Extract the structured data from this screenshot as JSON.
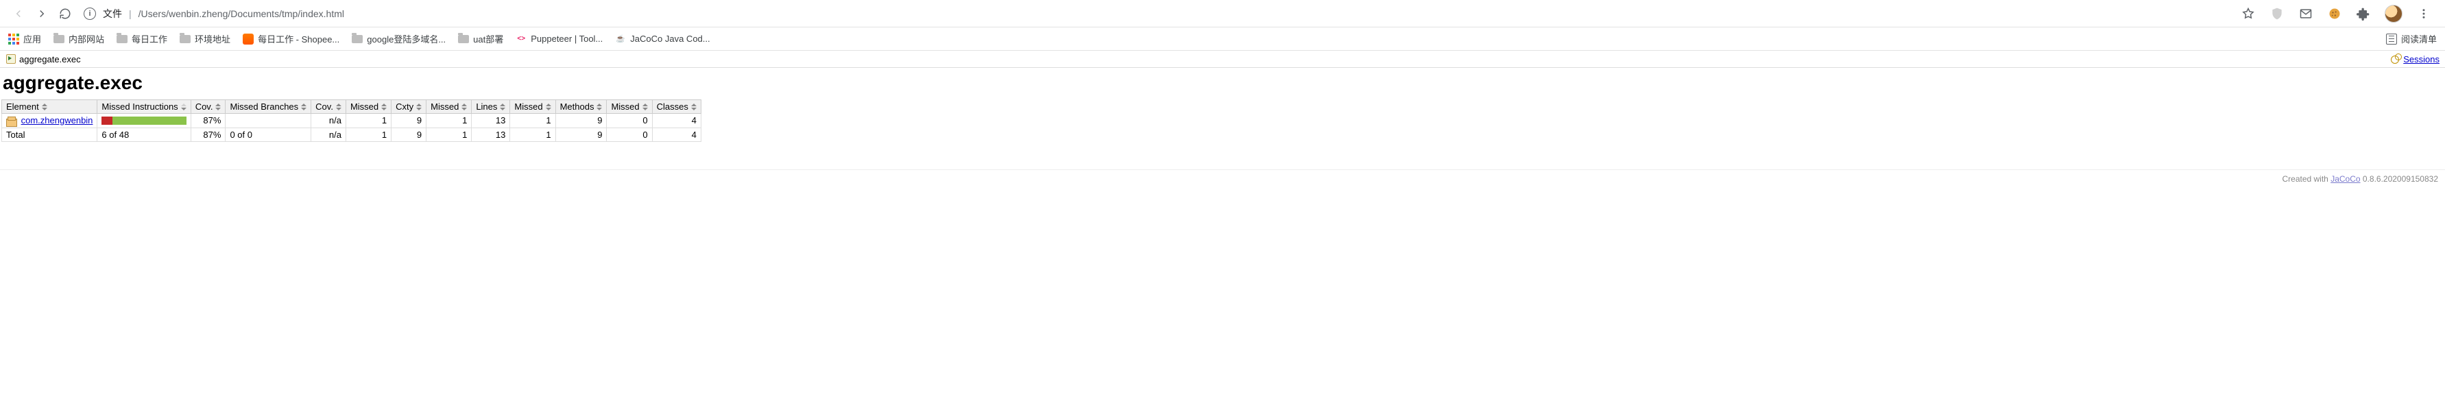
{
  "chrome": {
    "url_label": "文件",
    "url_path": "/Users/wenbin.zheng/Documents/tmp/index.html"
  },
  "bookmarks": {
    "apps": "应用",
    "items": [
      "内部网站",
      "每日工作",
      "环境地址"
    ],
    "shopee": "每日工作 - Shopee...",
    "google": "google登陆多域名...",
    "uat": "uat部署",
    "puppeteer": "Puppeteer   |   Tool...",
    "jacoco": "JaCoCo Java Cod...",
    "reading": "阅读清单"
  },
  "breadcrumb": {
    "current": "aggregate.exec",
    "sessions": "Sessions"
  },
  "title": "aggregate.exec",
  "headers": [
    "Element",
    "Missed Instructions",
    "Cov.",
    "Missed Branches",
    "Cov.",
    "Missed",
    "Cxty",
    "Missed",
    "Lines",
    "Missed",
    "Methods",
    "Missed",
    "Classes"
  ],
  "row": {
    "pkg": "com.zhengwenbin",
    "miss_pct": 13,
    "cov": "87%",
    "branches": "",
    "bcov": "n/a",
    "c_miss": "1",
    "c_tot": "9",
    "l_miss": "1",
    "l_tot": "13",
    "m_miss": "1",
    "m_tot": "9",
    "cl_miss": "0",
    "cl_tot": "4"
  },
  "total": {
    "label": "Total",
    "instr": "6 of 48",
    "cov": "87%",
    "br": "0 of 0",
    "bcov": "n/a",
    "c_miss": "1",
    "c_tot": "9",
    "l_miss": "1",
    "l_tot": "13",
    "m_miss": "1",
    "m_tot": "9",
    "cl_miss": "0",
    "cl_tot": "4"
  },
  "footer": {
    "created": "Created with ",
    "tool": "JaCoCo",
    "ver": " 0.8.6.202009150832"
  }
}
